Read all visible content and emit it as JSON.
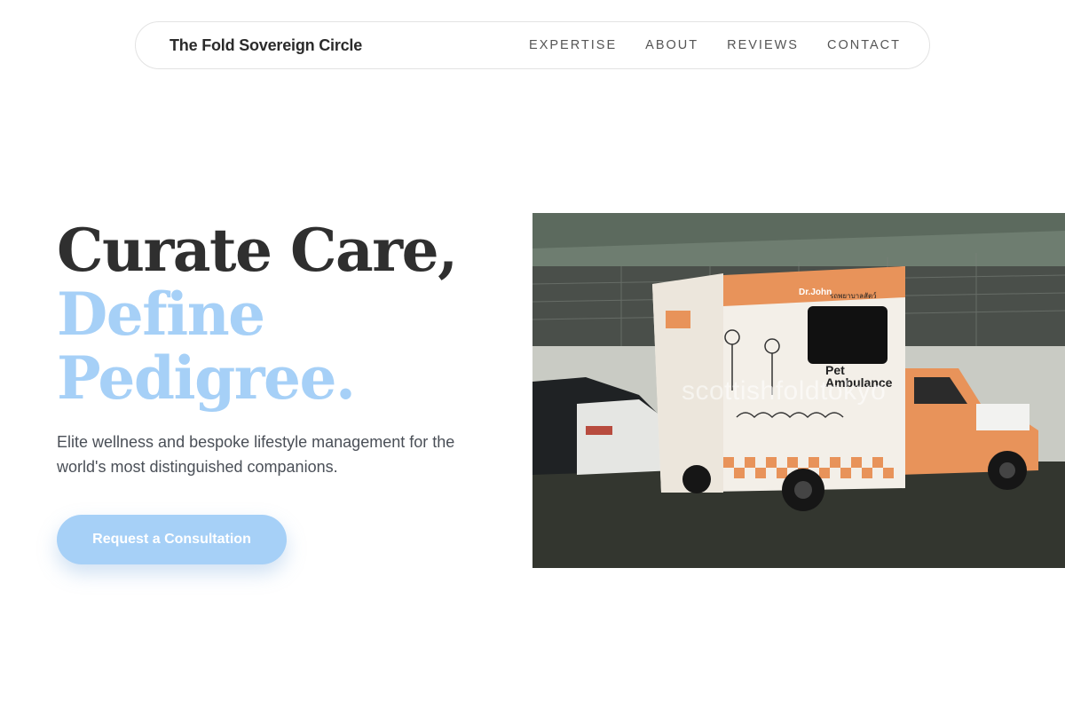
{
  "nav": {
    "brand": "The Fold Sovereign Circle",
    "links": [
      "EXPERTISE",
      "ABOUT",
      "REVIEWS",
      "CONTACT"
    ]
  },
  "hero": {
    "title_line1": "Curate Care,",
    "title_line2": "Define",
    "title_line3": "Pedigree.",
    "subtitle": "Elite wellness and bespoke lifestyle management for the world's most distinguished companions.",
    "cta_label": "Request a Consultation"
  },
  "photo": {
    "watermark": "scottishfoldtokyo",
    "vehicle_logo": "Dr.John",
    "vehicle_thai": "รถพยาบาลสัตว์",
    "vehicle_side_1": "Pet",
    "vehicle_side_2": "Ambulance"
  },
  "colors": {
    "accent": "#a6d0f7",
    "text_dark": "#2f2f2f",
    "truck_orange": "#e8935a"
  }
}
